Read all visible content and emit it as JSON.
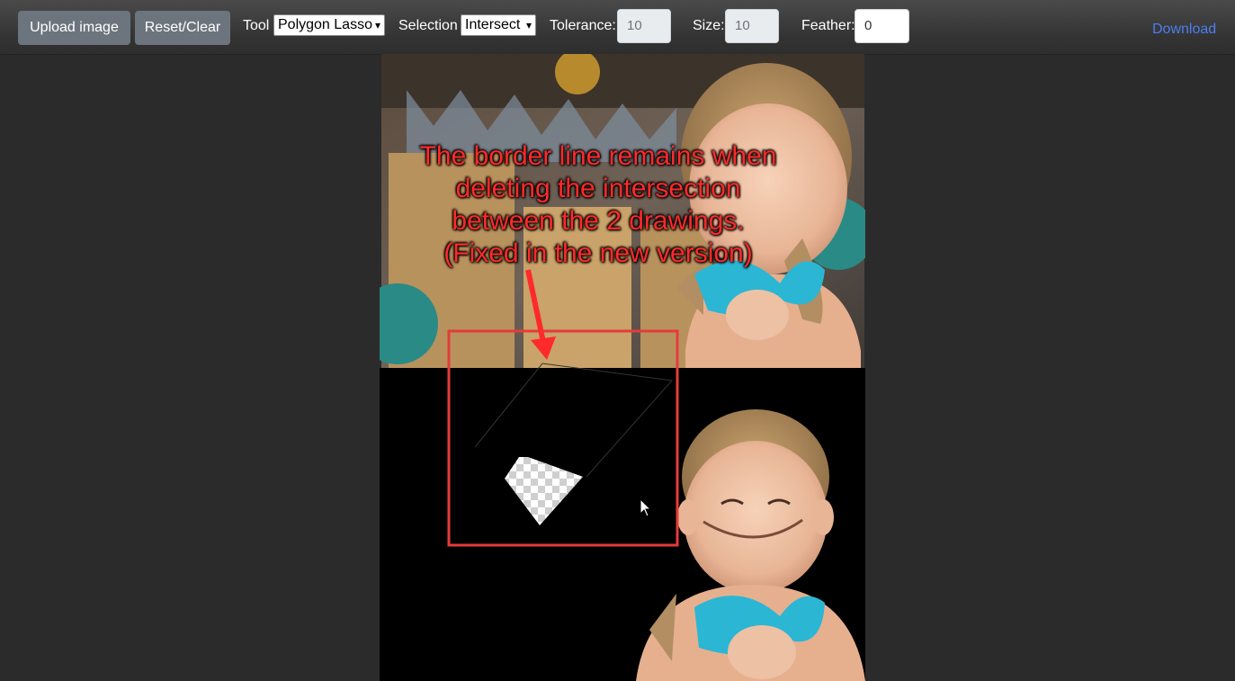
{
  "toolbar": {
    "upload_label": "Upload image",
    "reset_label": "Reset/Clear",
    "tool_label": "Tool",
    "tool_value": "Polygon Lasso",
    "selection_label": "Selection",
    "selection_value": "Intersect",
    "tolerance_label": "Tolerance:",
    "tolerance_value": "10",
    "size_label": "Size:",
    "size_value": "10",
    "feather_label": "Feather:",
    "feather_value": "0",
    "download_label": "Download"
  },
  "annotation": {
    "lines": [
      "The border line remains when",
      "deleting the intersection",
      "between the  2 drawings.",
      "(Fixed in the new version)"
    ],
    "color": "#ff2a2a"
  },
  "colors": {
    "button_bg": "#6c757d",
    "link": "#4d7df0",
    "highlight_box": "#e53b3b"
  }
}
